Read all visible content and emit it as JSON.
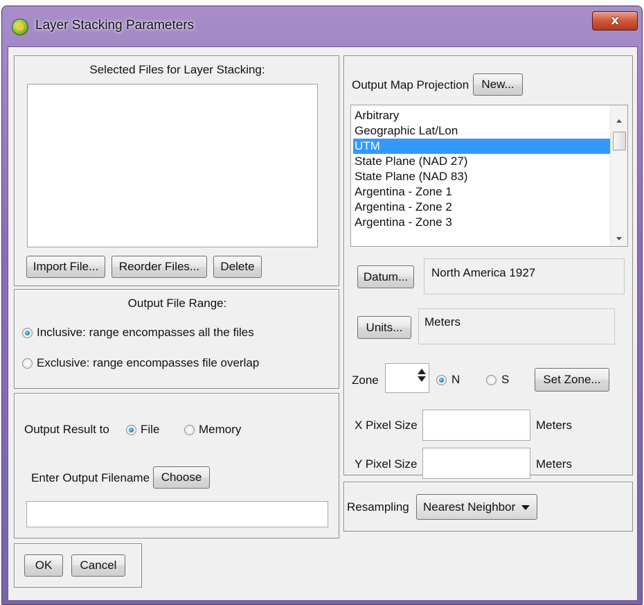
{
  "window": {
    "title": "Layer Stacking Parameters",
    "close_glyph": "x"
  },
  "selected_files": {
    "heading": "Selected Files for Layer Stacking:",
    "files": [],
    "import_label": "Import File...",
    "reorder_label": "Reorder Files...",
    "delete_label": "Delete"
  },
  "output_range": {
    "heading": "Output File Range:",
    "inclusive_label": "Inclusive: range encompasses all the files",
    "exclusive_label": "Exclusive: range encompasses file overlap",
    "selected": "inclusive"
  },
  "output_result": {
    "label": "Output Result to",
    "file_label": "File",
    "memory_label": "Memory",
    "selected": "file",
    "filename_label": "Enter Output Filename",
    "choose_label": "Choose",
    "filename_value": ""
  },
  "projection": {
    "label": "Output Map Projection",
    "new_label": "New...",
    "items": [
      "Arbitrary",
      "Geographic Lat/Lon",
      "UTM",
      "State Plane (NAD 27)",
      "State Plane (NAD 83)",
      "Argentina - Zone 1",
      "Argentina - Zone 2",
      "Argentina - Zone 3"
    ],
    "selected_index": 2,
    "datum_label": "Datum...",
    "datum_value": "North America 1927",
    "units_label": "Units...",
    "units_value": "Meters",
    "zone_label": "Zone",
    "zone_value": "",
    "n_label": "N",
    "s_label": "S",
    "hemisphere": "N",
    "set_zone_label": "Set Zone...",
    "x_pixel_label": "X Pixel Size",
    "x_pixel_value": "",
    "x_units": "Meters",
    "y_pixel_label": "Y Pixel Size",
    "y_pixel_value": "",
    "y_units": "Meters"
  },
  "resampling": {
    "label": "Resampling",
    "value": "Nearest Neighbor"
  },
  "footer": {
    "ok_label": "OK",
    "cancel_label": "Cancel"
  },
  "colors": {
    "selection": "#3399ff",
    "title_bar": "#8a6fb6",
    "close_button": "#c8462a"
  }
}
